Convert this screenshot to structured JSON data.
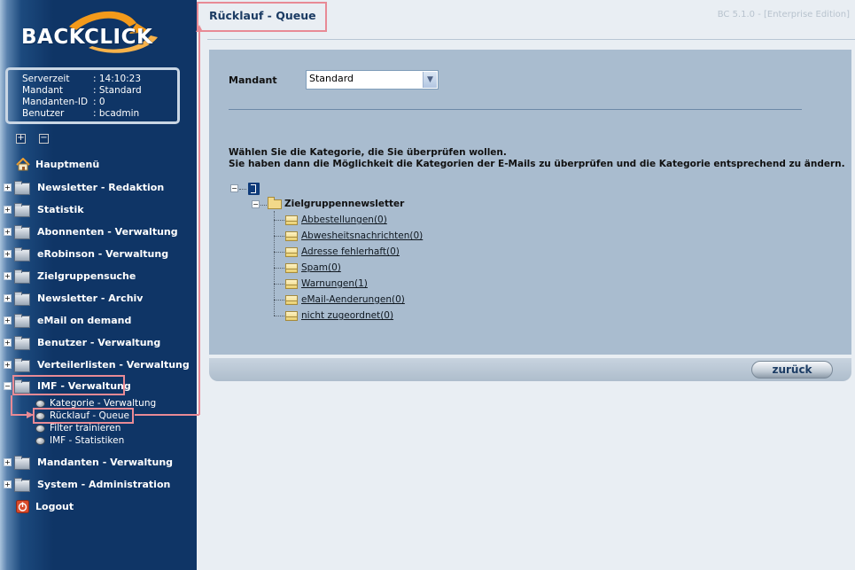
{
  "logo": {
    "text": "BACKCLICK"
  },
  "info": [
    {
      "key": "Serverzeit",
      "value": ": 14:10:23"
    },
    {
      "key": "Mandant",
      "value": ": Standard"
    },
    {
      "key": "Mandanten-ID",
      "value": ": 0"
    },
    {
      "key": "Benutzer",
      "value": ": bcadmin"
    }
  ],
  "expand_all": "+",
  "collapse_all": "−",
  "nav": [
    {
      "label": "Hauptmenü"
    },
    {
      "label": "Newsletter - Redaktion"
    },
    {
      "label": "Statistik"
    },
    {
      "label": "Abonnenten - Verwaltung"
    },
    {
      "label": "eRobinson - Verwaltung"
    },
    {
      "label": "Zielgruppensuche"
    },
    {
      "label": "Newsletter - Archiv"
    },
    {
      "label": "eMail on demand"
    },
    {
      "label": "Benutzer - Verwaltung"
    },
    {
      "label": "Verteilerlisten - Verwaltung"
    },
    {
      "label": "IMF - Verwaltung"
    },
    {
      "label": "Mandanten - Verwaltung"
    },
    {
      "label": "System - Administration"
    },
    {
      "label": "Logout"
    }
  ],
  "imf_sub": [
    {
      "label": "Kategorie - Verwaltung"
    },
    {
      "label": "Rücklauf - Queue"
    },
    {
      "label": "Filter trainieren"
    },
    {
      "label": "IMF - Statistiken"
    }
  ],
  "header": {
    "title": "Rücklauf - Queue",
    "version": "BC 5.1.0 - [Enterprise Edition]"
  },
  "form": {
    "mandant_label": "Mandant",
    "mandant_value": "Standard",
    "instruction_1": "Wählen Sie die Kategorie, die Sie überprüfen wollen.",
    "instruction_2": "Sie haben dann die Möglichkeit die Kategorien der E-Mails zu überprüfen und die Kategorie entsprechend zu ändern."
  },
  "tree": {
    "group": "Zielgruppennewsletter",
    "items": [
      {
        "label": "Abbestellungen(0)"
      },
      {
        "label": "Abwesheitsnachrichten(0)"
      },
      {
        "label": "Adresse fehlerhaft(0)"
      },
      {
        "label": "Spam(0)"
      },
      {
        "label": "Warnungen(1)"
      },
      {
        "label": "eMail-Aenderungen(0)"
      },
      {
        "label": "nicht zugeordnet(0)"
      }
    ]
  },
  "footer": {
    "back_label": "zurück"
  },
  "colors": {
    "sidebar": "#0f3566",
    "panel": "#a9bccf",
    "highlight": "#e88a95",
    "title": "#1b3b63"
  }
}
